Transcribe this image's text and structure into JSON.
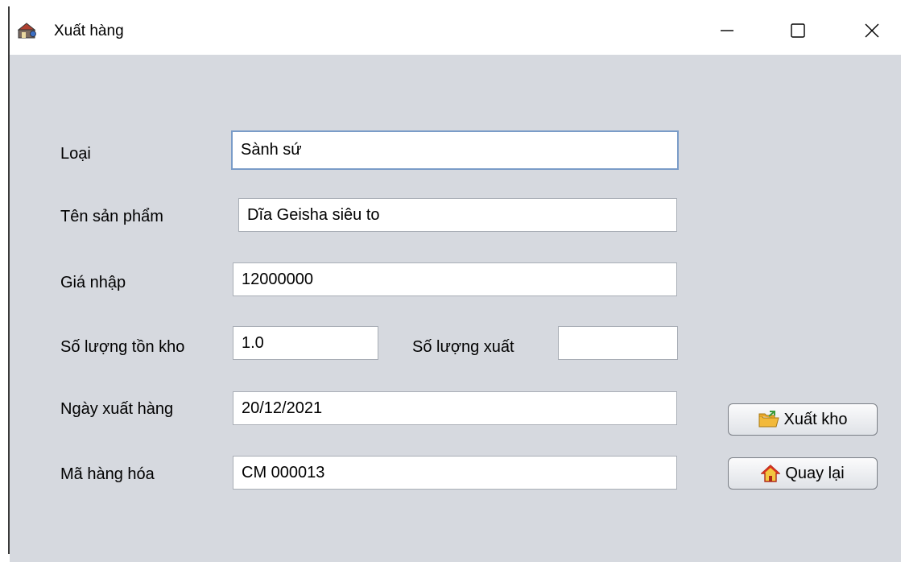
{
  "window": {
    "title": "Xuất hàng",
    "icon": "app-icon"
  },
  "controls": {
    "minimize_icon": "minimize-icon",
    "maximize_icon": "maximize-icon",
    "close_icon": "close-icon"
  },
  "form": {
    "loai": {
      "label": "Loại",
      "value": "Sành sứ"
    },
    "ten_san_pham": {
      "label": "Tên sản phẩm",
      "value": "Dĩa Geisha siêu to"
    },
    "gia_nhap": {
      "label": "Giá nhập",
      "value": "12000000"
    },
    "so_luong_ton_kho": {
      "label": "Số lượng tồn kho",
      "value": "1.0"
    },
    "so_luong_xuat": {
      "label": "Số lượng xuất",
      "value": ""
    },
    "ngay_xuat_hang": {
      "label": "Ngày xuất hàng",
      "value": "20/12/2021"
    },
    "ma_hang_hoa": {
      "label": "Mã hàng hóa",
      "value": "CM 000013"
    }
  },
  "buttons": {
    "xuat_kho": {
      "label": "Xuất kho",
      "icon": "folder-export-icon"
    },
    "quay_lai": {
      "label": "Quay lại",
      "icon": "home-icon"
    }
  }
}
